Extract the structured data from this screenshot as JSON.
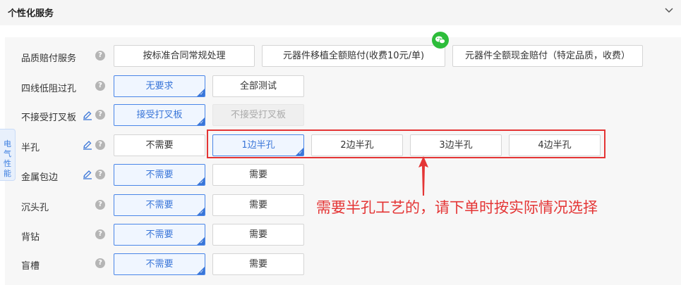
{
  "header": {
    "title": "个性化服务",
    "chevron_icon": "chevron-down-icon"
  },
  "side_tab": {
    "label": "电气性能"
  },
  "rows": [
    {
      "label": "品质赔付服务",
      "options": [
        "按标准合同常规处理",
        "元器件移植全额赔付(收费10元/单)",
        "元器件全额现金赔付（特定品质，收费）"
      ]
    },
    {
      "label": "四线低阻过孔",
      "options": [
        "无要求",
        "全部测试"
      ],
      "selected": "无要求"
    },
    {
      "label": "不接受打叉板",
      "options": [
        "接受打叉板",
        "不接受打叉板"
      ],
      "selected": "接受打叉板",
      "disabled": "不接受打叉板"
    },
    {
      "label": "半孔",
      "options": [
        "不需要",
        "1边半孔",
        "2边半孔",
        "3边半孔",
        "4边半孔"
      ],
      "selected": "1边半孔"
    },
    {
      "label": "金属包边",
      "options": [
        "不需要",
        "需要"
      ],
      "selected": "不需要"
    },
    {
      "label": "沉头孔",
      "options": [
        "不需要",
        "需要"
      ],
      "selected": "不需要"
    },
    {
      "label": "背钻",
      "options": [
        "不需要",
        "需要"
      ],
      "selected": "不需要"
    },
    {
      "label": "盲槽",
      "options": [
        "不需要",
        "需要"
      ],
      "selected": "不需要"
    }
  ],
  "annotation": {
    "text": "需要半孔工艺的，请下单时按实际情况选择",
    "color": "#e43535"
  },
  "colors": {
    "accent": "#3a76d8",
    "highlight": "#e43535",
    "wechat": "#2dbd3a"
  }
}
